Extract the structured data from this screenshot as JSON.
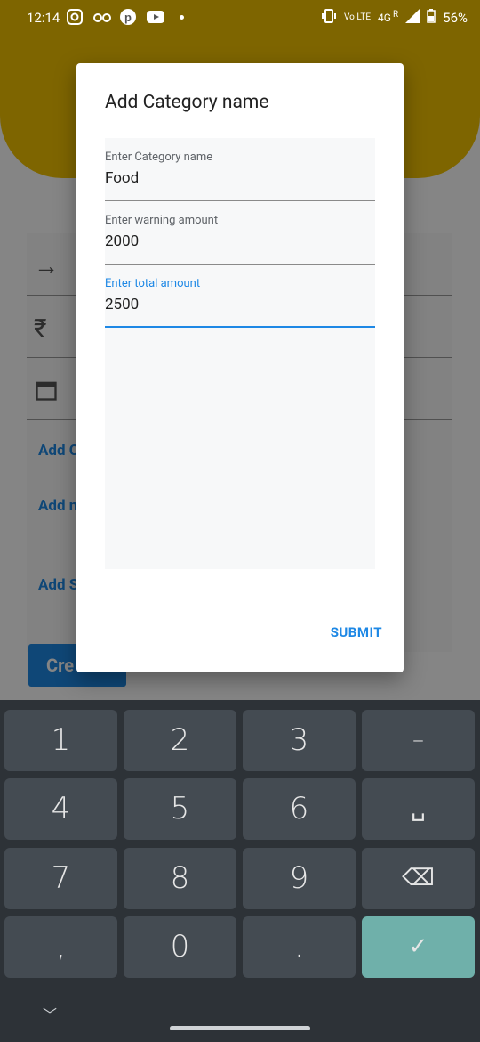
{
  "status_bar": {
    "time": "12:14",
    "battery": "56%",
    "network": "4G",
    "lte": "Vo LTE",
    "roaming": "R",
    "icons": [
      "instagram-icon",
      "glasses-icon",
      "pinterest-icon",
      "youtube-icon"
    ]
  },
  "background": {
    "links": [
      "Add C",
      "Add n",
      "Add S"
    ],
    "create_button": "Cre"
  },
  "dialog": {
    "title": "Add Category name",
    "fields": [
      {
        "label": "Enter Category name",
        "value": "Food"
      },
      {
        "label": "Enter warning amount",
        "value": "2000"
      },
      {
        "label": "Enter total amount",
        "value": "2500",
        "focused": true
      }
    ],
    "submit_label": "SUBMIT"
  },
  "keyboard": {
    "rows": [
      [
        "1",
        "2",
        "3",
        "–"
      ],
      [
        "4",
        "5",
        "6",
        "␣"
      ],
      [
        "7",
        "8",
        "9",
        "⌫"
      ],
      [
        ",",
        "0",
        ".",
        "✓"
      ]
    ]
  },
  "colors": {
    "accent": "#1e88e5",
    "header_yellow": "#f2c200",
    "keyboard_bg": "#2d3237",
    "key_bg": "#444b52",
    "done_key": "#6fb0aa"
  }
}
